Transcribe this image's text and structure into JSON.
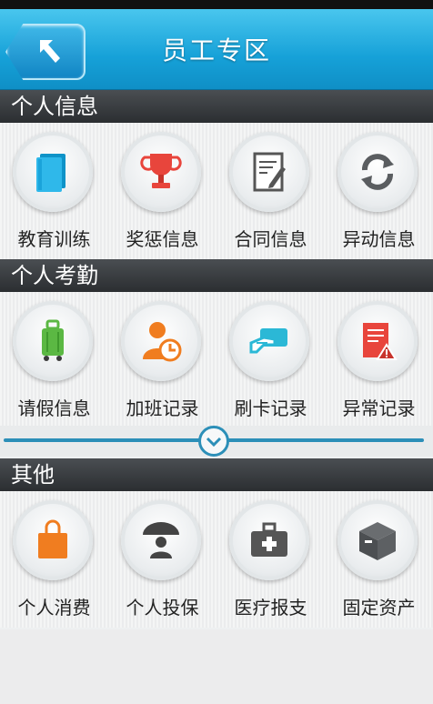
{
  "header": {
    "title": "员工专区"
  },
  "sections": [
    {
      "title": "个人信息",
      "items": [
        {
          "label": "教育训练",
          "icon": "books-icon"
        },
        {
          "label": "奖惩信息",
          "icon": "trophy-icon"
        },
        {
          "label": "合同信息",
          "icon": "contract-icon"
        },
        {
          "label": "异动信息",
          "icon": "refresh-icon"
        }
      ]
    },
    {
      "title": "个人考勤",
      "items": [
        {
          "label": "请假信息",
          "icon": "luggage-icon"
        },
        {
          "label": "加班记录",
          "icon": "overtime-clock-icon"
        },
        {
          "label": "刷卡记录",
          "icon": "card-swipe-icon"
        },
        {
          "label": "异常记录",
          "icon": "document-warning-icon"
        }
      ]
    },
    {
      "title": "其他",
      "items": [
        {
          "label": "个人消费",
          "icon": "shopping-bag-icon"
        },
        {
          "label": "个人投保",
          "icon": "umbrella-person-icon"
        },
        {
          "label": "医疗报支",
          "icon": "medical-kit-icon"
        },
        {
          "label": "固定资产",
          "icon": "box-icon"
        }
      ]
    }
  ],
  "colors": {
    "accent": "#16a1d8",
    "section_bar": "#2b2e31",
    "divider": "#2c8fb8"
  }
}
